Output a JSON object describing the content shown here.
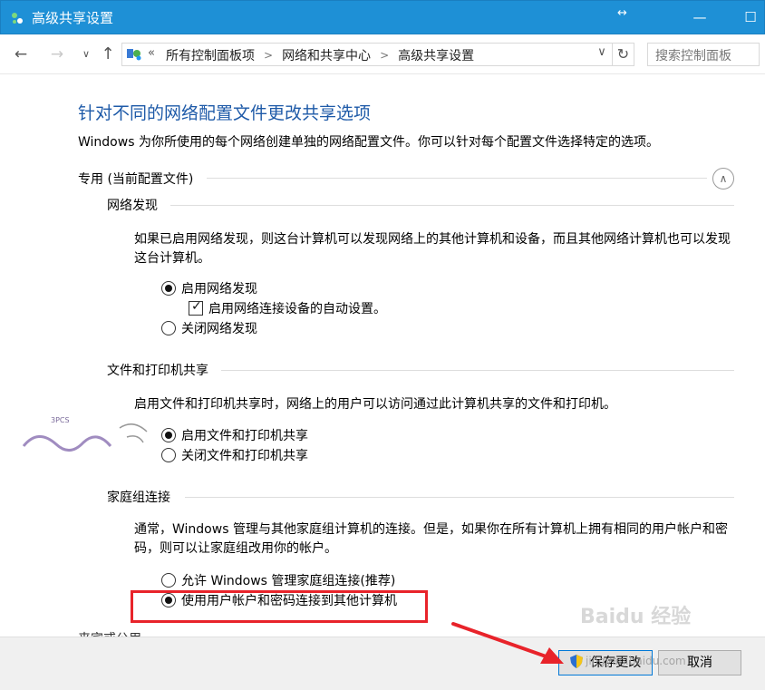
{
  "window": {
    "title": "高级共享设置",
    "minimize": "—",
    "maximize": "☐",
    "resize_glyph": "↔"
  },
  "nav": {
    "back": "←",
    "forward": "→",
    "recent": "∨",
    "up": "↑",
    "address_prefix": "«",
    "breadcrumbs": [
      "所有控制面板项",
      "网络和共享中心",
      "高级共享设置"
    ],
    "dropdown": "∨",
    "refresh": "↻",
    "search_placeholder": "搜索控制面板"
  },
  "page": {
    "title": "针对不同的网络配置文件更改共享选项",
    "description": "Windows 为你所使用的每个网络创建单独的网络配置文件。你可以针对每个配置文件选择特定的选项。",
    "profile_label": "专用 (当前配置文件)",
    "collapse": "∧",
    "next_profile": "来宾或公用"
  },
  "network_discovery": {
    "heading": "网络发现",
    "description": "如果已启用网络发现，则这台计算机可以发现网络上的其他计算机和设备，而且其他网络计算机也可以发现这台计算机。",
    "options": [
      {
        "label": "启用网络发现",
        "checked": true
      },
      {
        "label": "关闭网络发现",
        "checked": false
      }
    ],
    "auto_setup": {
      "label": "启用网络连接设备的自动设置。",
      "checked": true
    }
  },
  "file_printer_sharing": {
    "heading": "文件和打印机共享",
    "description": "启用文件和打印机共享时，网络上的用户可以访问通过此计算机共享的文件和打印机。",
    "options": [
      {
        "label": "启用文件和打印机共享",
        "checked": true
      },
      {
        "label": "关闭文件和打印机共享",
        "checked": false
      }
    ]
  },
  "homegroup": {
    "heading": "家庭组连接",
    "description": "通常，Windows 管理与其他家庭组计算机的连接。但是，如果你在所有计算机上拥有相同的用户帐户和密码，则可以让家庭组改用你的帐户。",
    "options": [
      {
        "label": "允许 Windows 管理家庭组连接(推荐)",
        "checked": false
      },
      {
        "label": "使用用户帐户和密码连接到其他计算机",
        "checked": true
      }
    ]
  },
  "footer": {
    "save": "保存更改",
    "cancel": "取消"
  },
  "watermarks": {
    "baidu": "Baidu 经验",
    "baidu_sub": "jingyan.baidu.com",
    "logo_text": "3PCS"
  },
  "colors": {
    "titlebar": "#1e90d6",
    "title_blue": "#1e5aa8",
    "highlight_red": "#e8232a"
  }
}
